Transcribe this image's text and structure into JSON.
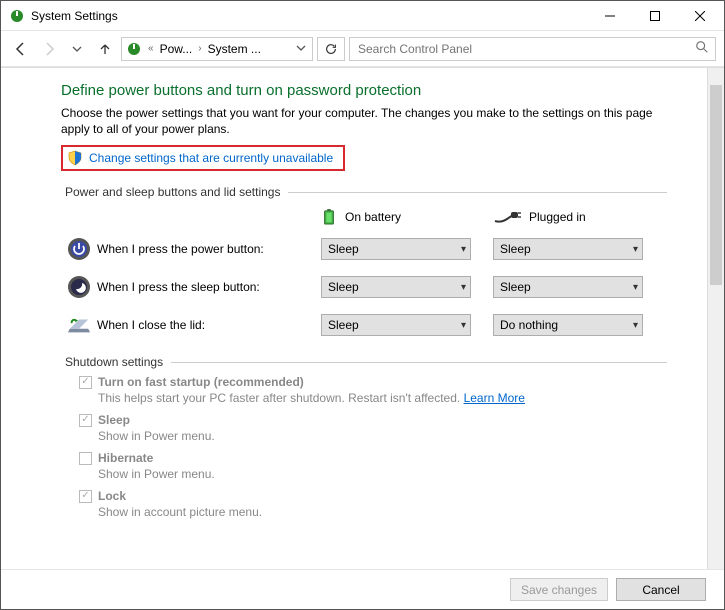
{
  "window": {
    "title": "System Settings"
  },
  "nav": {
    "crumb_prefix": "«",
    "crumb1": "Pow...",
    "crumb2": "System ...",
    "search_placeholder": "Search Control Panel"
  },
  "page": {
    "heading": "Define power buttons and turn on password protection",
    "description": "Choose the power settings that you want for your computer. The changes you make to the settings on this page apply to all of your power plans.",
    "change_link": "Change settings that are currently unavailable"
  },
  "group1": {
    "legend": "Power and sleep buttons and lid settings",
    "col_battery": "On battery",
    "col_plugged": "Plugged in",
    "rows": [
      {
        "label": "When I press the power button:",
        "battery": "Sleep",
        "plugged": "Sleep"
      },
      {
        "label": "When I press the sleep button:",
        "battery": "Sleep",
        "plugged": "Sleep"
      },
      {
        "label": "When I close the lid:",
        "battery": "Sleep",
        "plugged": "Do nothing"
      }
    ]
  },
  "group2": {
    "legend": "Shutdown settings",
    "items": [
      {
        "checked": true,
        "label": "Turn on fast startup (recommended)",
        "desc": "This helps start your PC faster after shutdown. Restart isn't affected.",
        "link": "Learn More"
      },
      {
        "checked": true,
        "label": "Sleep",
        "desc": "Show in Power menu."
      },
      {
        "checked": false,
        "label": "Hibernate",
        "desc": "Show in Power menu."
      },
      {
        "checked": true,
        "label": "Lock",
        "desc": "Show in account picture menu."
      }
    ]
  },
  "footer": {
    "save": "Save changes",
    "cancel": "Cancel"
  }
}
